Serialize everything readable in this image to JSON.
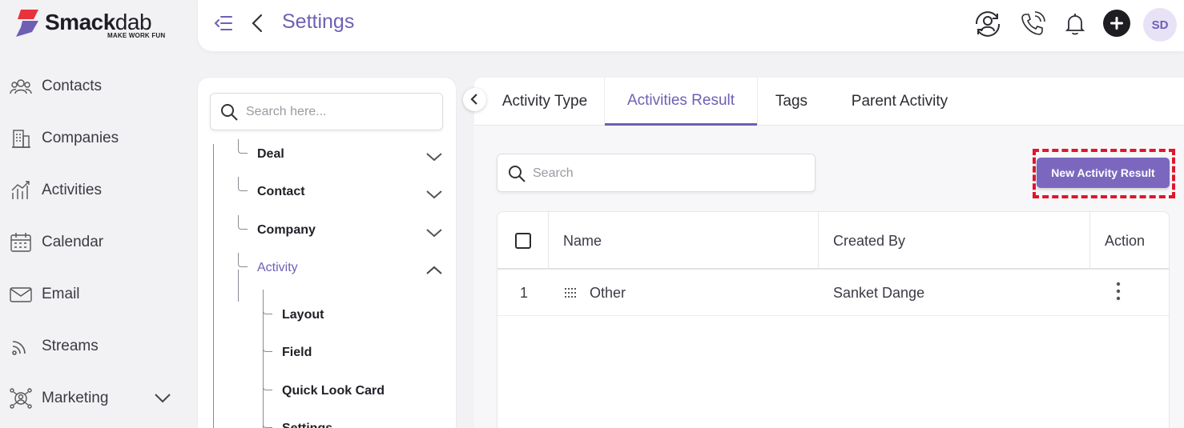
{
  "brand": {
    "name_bold": "Smack",
    "name_light": "dab",
    "tagline": "MAKE WORK FUN"
  },
  "sidebar": {
    "items": [
      {
        "label": "Contacts",
        "icon": "contacts-icon"
      },
      {
        "label": "Companies",
        "icon": "companies-icon"
      },
      {
        "label": "Activities",
        "icon": "activities-icon"
      },
      {
        "label": "Calendar",
        "icon": "calendar-icon"
      },
      {
        "label": "Email",
        "icon": "email-icon"
      },
      {
        "label": "Streams",
        "icon": "streams-icon"
      },
      {
        "label": "Marketing",
        "icon": "marketing-icon"
      }
    ]
  },
  "header": {
    "title": "Settings",
    "avatar_initials": "SD"
  },
  "tree": {
    "search_placeholder": "Search here...",
    "items": [
      {
        "label": "Deal"
      },
      {
        "label": "Contact"
      },
      {
        "label": "Company"
      },
      {
        "label": "Activity"
      }
    ],
    "sub_items": [
      {
        "label": "Layout"
      },
      {
        "label": "Field"
      },
      {
        "label": "Quick Look Card"
      },
      {
        "label": "Settings"
      }
    ]
  },
  "tabs": [
    {
      "label": "Activity Type"
    },
    {
      "label": "Activities Result"
    },
    {
      "label": "Tags"
    },
    {
      "label": "Parent Activity"
    }
  ],
  "content": {
    "search_placeholder": "Search",
    "new_button_label": "New Activity Result",
    "table": {
      "headers": {
        "name": "Name",
        "created_by": "Created By",
        "action": "Action"
      },
      "rows": [
        {
          "index": "1",
          "name": "Other",
          "created_by": "Sanket Dange"
        }
      ]
    }
  },
  "colors": {
    "accent": "#6e5fb5",
    "button": "#7b68be",
    "highlight": "#e0162b",
    "brand_red": "#e8333c"
  }
}
